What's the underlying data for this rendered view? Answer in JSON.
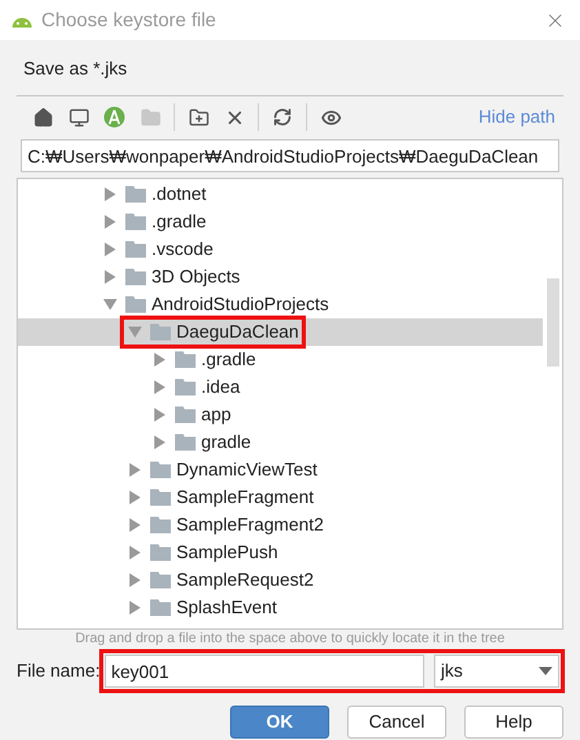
{
  "window": {
    "title": "Choose keystore file"
  },
  "description": "Save as *.jks",
  "toolbar": {
    "tools": [
      {
        "kind": "home",
        "disabled": false
      },
      {
        "kind": "desktop",
        "disabled": false
      },
      {
        "kind": "project",
        "disabled": false
      },
      {
        "kind": "module",
        "disabled": true
      },
      {
        "kind": "separator"
      },
      {
        "kind": "new-folder",
        "disabled": false
      },
      {
        "kind": "delete",
        "disabled": false
      },
      {
        "kind": "separator"
      },
      {
        "kind": "refresh",
        "disabled": false
      },
      {
        "kind": "separator"
      },
      {
        "kind": "hidden",
        "disabled": false
      }
    ],
    "link": "Hide path"
  },
  "path": {
    "value": "C:₩Users₩wonpaper₩AndroidStudioProjects₩DaeguDaClean"
  },
  "tree": [
    {
      "label": ".dotnet",
      "expanded": false,
      "selected": false,
      "highlighted": false
    },
    {
      "label": ".gradle",
      "expanded": false,
      "selected": false,
      "highlighted": false
    },
    {
      "label": ".vscode",
      "expanded": false,
      "selected": false,
      "highlighted": false
    },
    {
      "label": "3D Objects",
      "expanded": false,
      "selected": false,
      "highlighted": false
    },
    {
      "label": "AndroidStudioProjects",
      "expanded": true,
      "selected": false,
      "highlighted": false,
      "children": [
        {
          "label": "DaeguDaClean",
          "expanded": true,
          "selected": true,
          "highlighted": true,
          "children": [
            {
              "label": ".gradle",
              "expanded": false,
              "selected": false,
              "highlighted": false
            },
            {
              "label": ".idea",
              "expanded": false,
              "selected": false,
              "highlighted": false
            },
            {
              "label": "app",
              "expanded": false,
              "selected": false,
              "highlighted": false
            },
            {
              "label": "gradle",
              "expanded": false,
              "selected": false,
              "highlighted": false
            }
          ]
        },
        {
          "label": "DynamicViewTest",
          "expanded": false,
          "selected": false,
          "highlighted": false
        },
        {
          "label": "SampleFragment",
          "expanded": false,
          "selected": false,
          "highlighted": false
        },
        {
          "label": "SampleFragment2",
          "expanded": false,
          "selected": false,
          "highlighted": false
        },
        {
          "label": "SamplePush",
          "expanded": false,
          "selected": false,
          "highlighted": false
        },
        {
          "label": "SampleRequest2",
          "expanded": false,
          "selected": false,
          "highlighted": false
        },
        {
          "label": "SplashEvent",
          "expanded": false,
          "selected": false,
          "highlighted": false
        }
      ]
    }
  ],
  "hint": "Drag and drop a file into the space above to quickly locate it in the tree",
  "file_name": {
    "label": "File name:",
    "value": "key001",
    "type": "jks",
    "highlighted": true
  },
  "buttons": [
    {
      "label": "OK",
      "kind": "primary"
    },
    {
      "label": "Cancel",
      "kind": "normal"
    },
    {
      "label": "Help",
      "kind": "normal"
    }
  ]
}
